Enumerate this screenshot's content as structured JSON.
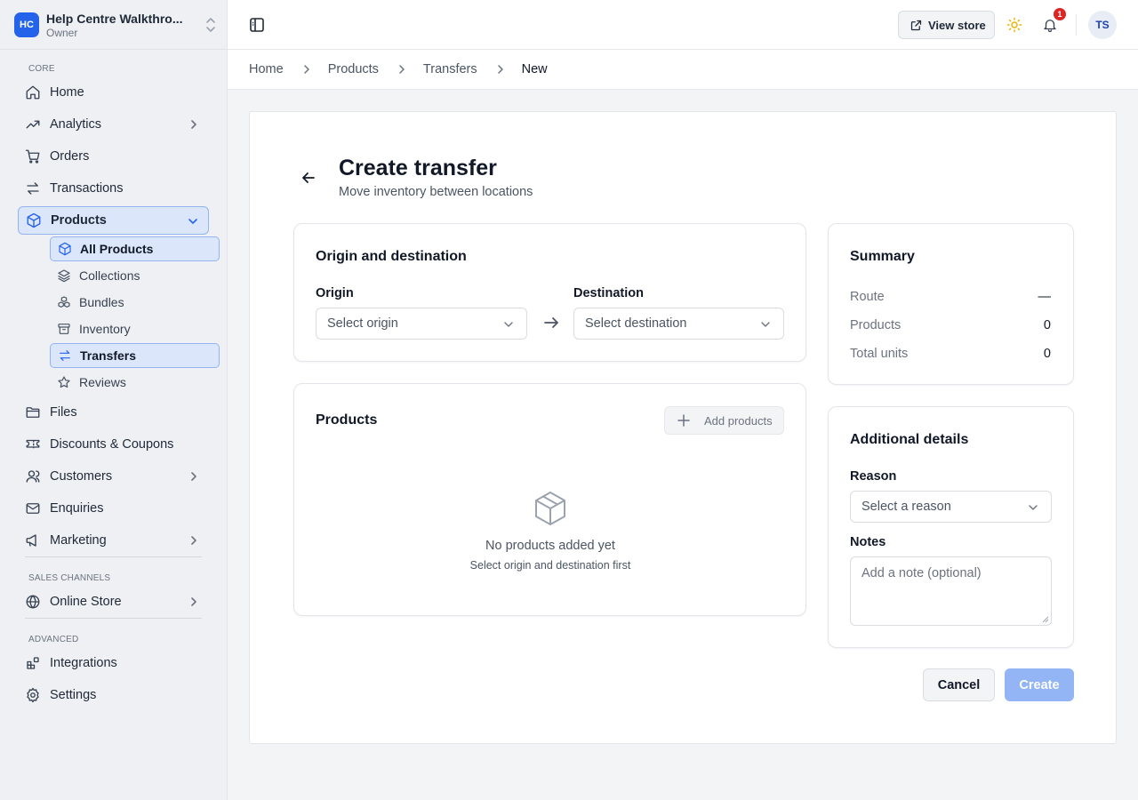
{
  "workspace": {
    "initials": "HC",
    "name": "Help Centre Walkthro...",
    "role": "Owner"
  },
  "sidebar": {
    "sections": {
      "core": "CORE",
      "sales_channels": "SALES CHANNELS",
      "advanced": "ADVANCED"
    },
    "items": {
      "home": "Home",
      "analytics": "Analytics",
      "orders": "Orders",
      "transactions": "Transactions",
      "products": "Products",
      "files": "Files",
      "discounts": "Discounts & Coupons",
      "customers": "Customers",
      "enquiries": "Enquiries",
      "marketing": "Marketing",
      "online_store": "Online Store",
      "integrations": "Integrations",
      "settings": "Settings"
    },
    "products_sub": {
      "all_products": "All Products",
      "collections": "Collections",
      "bundles": "Bundles",
      "inventory": "Inventory",
      "transfers": "Transfers",
      "reviews": "Reviews"
    }
  },
  "topbar": {
    "view_store": "View store",
    "notification_count": "1",
    "avatar_initials": "TS"
  },
  "breadcrumb": [
    "Home",
    "Products",
    "Transfers",
    "New"
  ],
  "page": {
    "title": "Create transfer",
    "subtitle": "Move inventory between locations"
  },
  "origin_card": {
    "title": "Origin and destination",
    "origin_label": "Origin",
    "origin_placeholder": "Select origin",
    "destination_label": "Destination",
    "destination_placeholder": "Select destination"
  },
  "products_card": {
    "title": "Products",
    "add_button": "Add products",
    "empty_title": "No products added yet",
    "empty_subtitle": "Select origin and destination first"
  },
  "summary": {
    "title": "Summary",
    "route_label": "Route",
    "route_value": "—",
    "products_label": "Products",
    "products_value": "0",
    "units_label": "Total units",
    "units_value": "0"
  },
  "details": {
    "title": "Additional details",
    "reason_label": "Reason",
    "reason_placeholder": "Select a reason",
    "notes_label": "Notes",
    "notes_placeholder": "Add a note (optional)"
  },
  "actions": {
    "cancel": "Cancel",
    "create": "Create"
  },
  "colors": {
    "accent": "#2563eb",
    "active_bg": "#dbe6fb",
    "create_disabled": "#93b4f5",
    "badge": "#dc2626",
    "sun": "#eab308"
  }
}
